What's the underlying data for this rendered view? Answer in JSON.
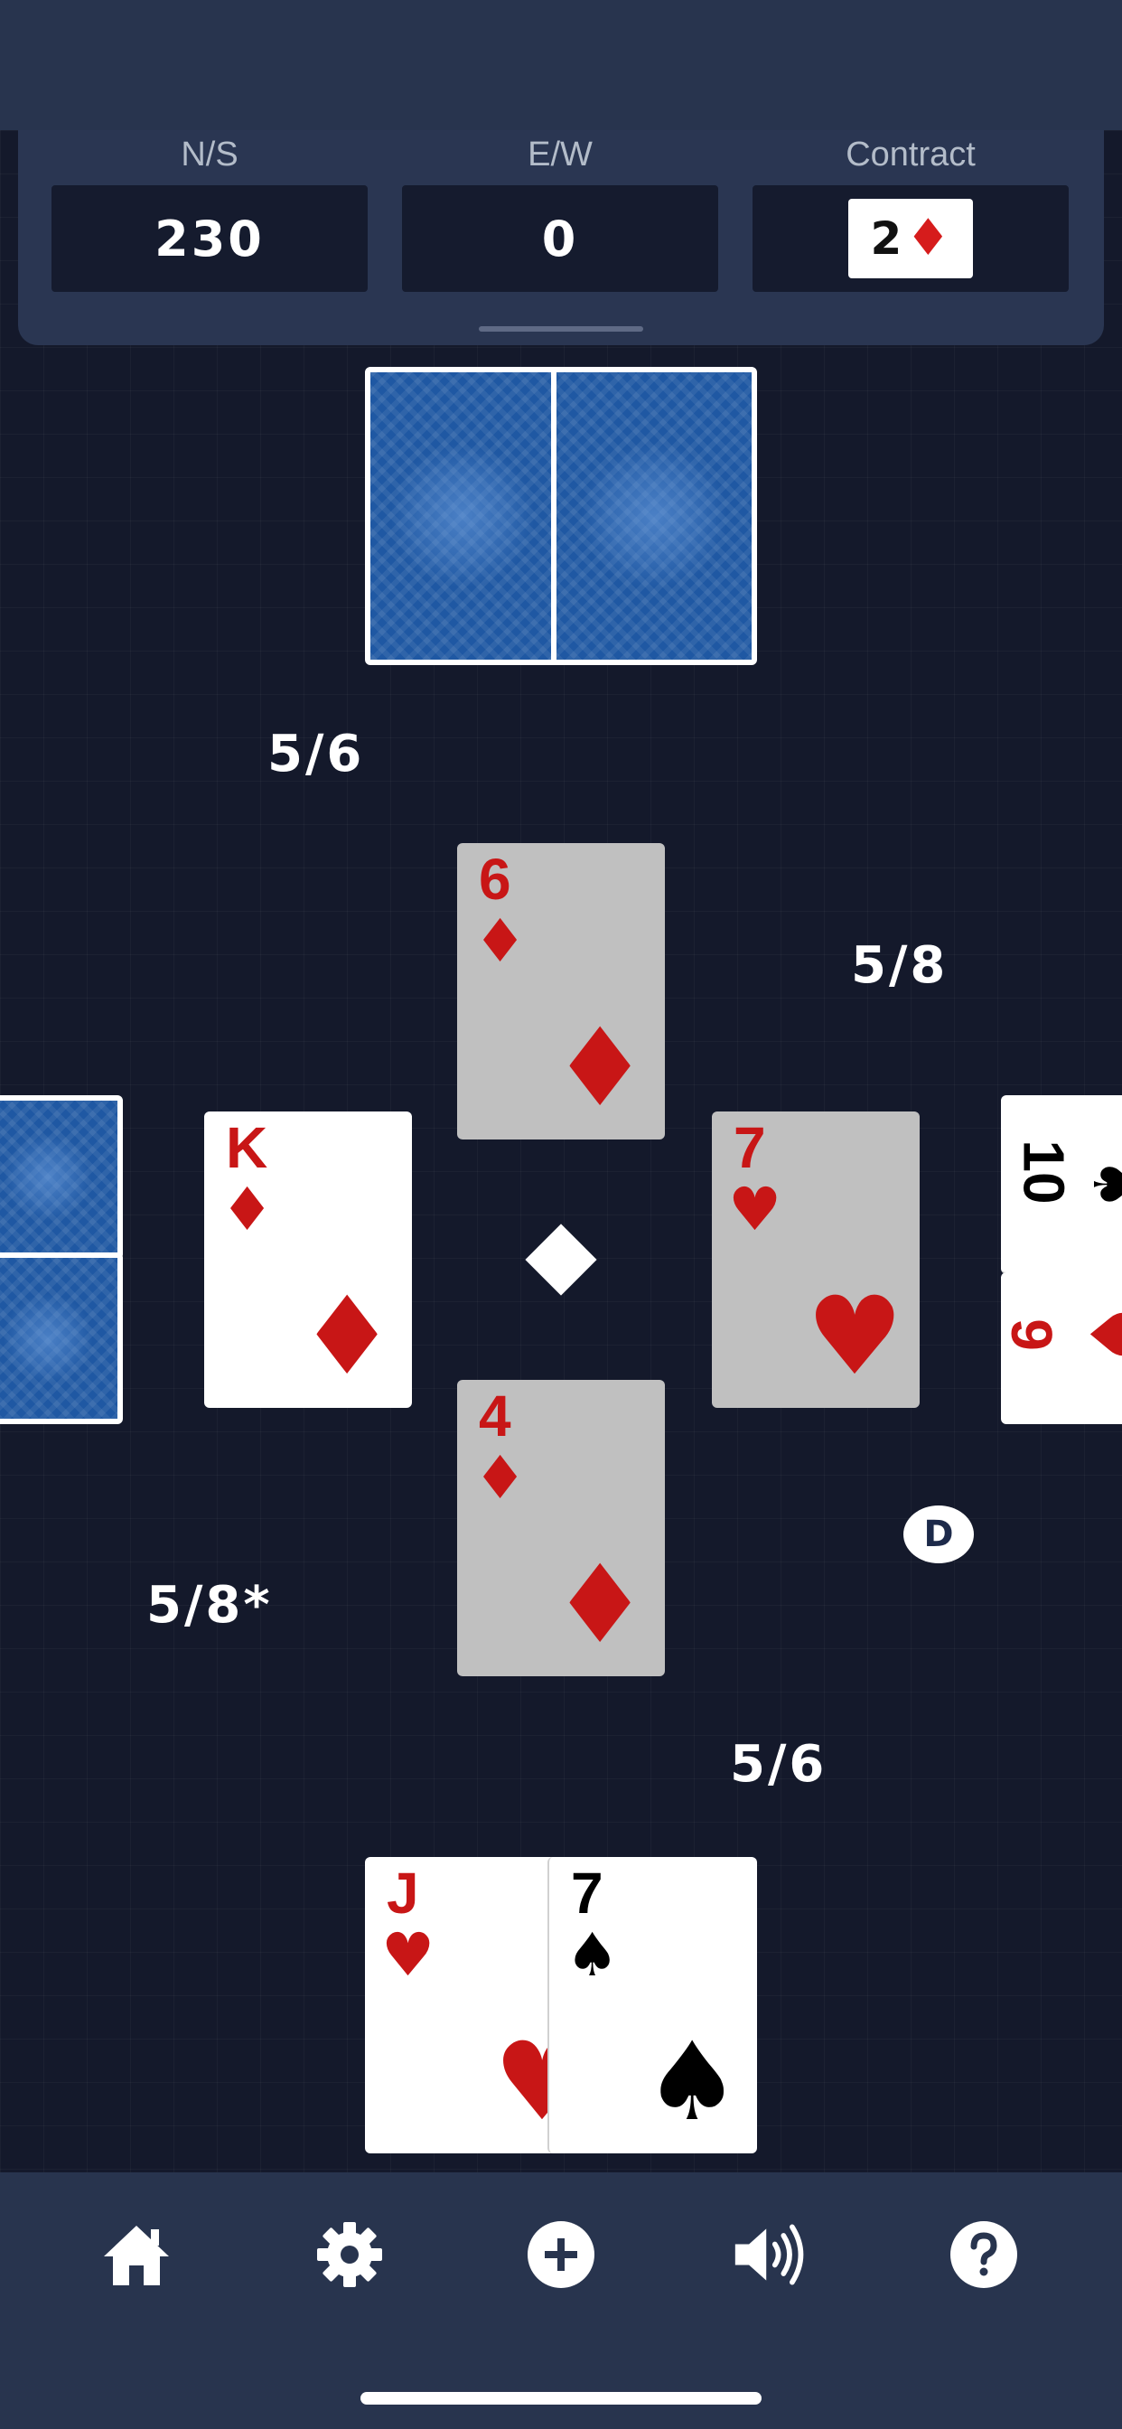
{
  "scoreboard": {
    "ns_label": "N/S",
    "ns_score": "230",
    "ew_label": "E/W",
    "ew_score": "0",
    "contract_label": "Contract",
    "contract_level": "2",
    "contract_suit": "♦"
  },
  "table": {
    "north_count": "5/6",
    "east_count": "5/8",
    "west_count": "5/8*",
    "south_count": "5/6",
    "dealer_badge": "D",
    "trump_suit_indicator": "diamond"
  },
  "trick": {
    "north_card": {
      "rank": "6",
      "suit": "♦"
    },
    "west_card": {
      "rank": "K",
      "suit": "♦"
    },
    "east_card": {
      "rank": "7",
      "suit": "♥"
    },
    "south_card": {
      "rank": "4",
      "suit": "♦"
    }
  },
  "east_hand_visible": {
    "card1_rank": "10",
    "card1_suit": "♠",
    "card2_rank": "9",
    "card2_suit": "♥"
  },
  "south_hand": {
    "card1": {
      "rank": "J",
      "suit": "♥"
    },
    "card2": {
      "rank": "7",
      "suit": "♠"
    }
  },
  "bottom_nav": {
    "icons": [
      "home-icon",
      "gear-icon",
      "plus-circle-icon",
      "speaker-icon",
      "help-icon"
    ]
  },
  "colors": {
    "background": "#14192b",
    "panel": "#2a3652",
    "red_suit": "#c81616",
    "card_back": "#1f58a3"
  }
}
